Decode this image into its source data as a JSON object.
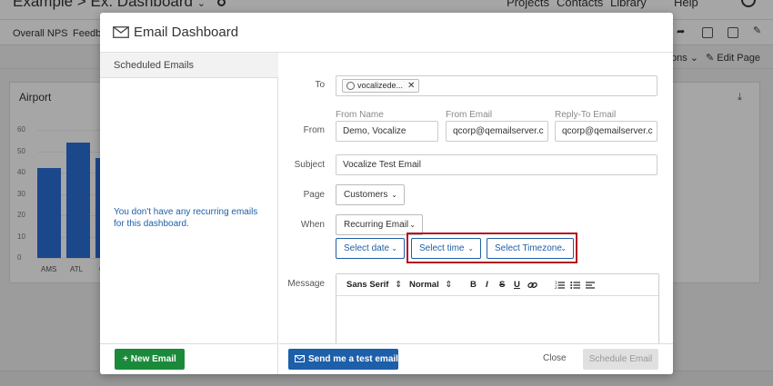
{
  "background": {
    "title": "Example  >  Ex. Dashboard",
    "title_chevron": "⌄",
    "settings_icon": "gear-icon",
    "top_nav": [
      "Projects",
      "Contacts",
      "Library",
      "Help"
    ],
    "tabs": [
      "Overall NPS",
      "Feedba"
    ],
    "sub_items": [
      "ons ⌄",
      "✎ Edit Page"
    ],
    "card_title": "Airport",
    "download_icon": "download-icon",
    "chart_data": {
      "type": "bar",
      "categories": [
        "AMS",
        "ATL",
        "C"
      ],
      "values": [
        42,
        54,
        47
      ],
      "ylim": [
        0,
        60
      ],
      "yticks": [
        "60",
        "50",
        "40",
        "30",
        "20",
        "10",
        "0"
      ],
      "bar_color": "#2a6ed6",
      "grid": true
    }
  },
  "modal": {
    "title": "Email Dashboard",
    "left": {
      "header": "Scheduled Emails",
      "empty_message": "You don't have any recurring emails for this dashboard.",
      "new_email_label": "+ New Email"
    },
    "form": {
      "to_label": "To",
      "to_chip": "vocalizede...",
      "to_chip_remove": "✕",
      "from_label": "From",
      "from_name_label": "From Name",
      "from_name_value": "Demo, Vocalize",
      "from_email_label": "From Email",
      "from_email_value": "qcorp@qemailserver.c",
      "reply_to_label": "Reply-To Email",
      "reply_to_value": "qcorp@qemailserver.c",
      "subject_label": "Subject",
      "subject_value": "Vocalize Test Email",
      "page_label": "Page",
      "page_value": "Customers",
      "when_label": "When",
      "when_value": "Recurring Email",
      "select_date": "Select date",
      "select_time": "Select time",
      "select_timezone": "Select Timezone",
      "message_label": "Message",
      "chevron": "⌄"
    },
    "editor_toolbar": {
      "font": "Sans Serif",
      "size": "Normal",
      "spinner": "⇕",
      "bold": "B",
      "italic": "I",
      "strike": "S",
      "underline": "U",
      "link_icon": "link-icon",
      "ordered_list_icon": "ordered-list-icon",
      "bullet_list_icon": "bullet-list-icon",
      "align_icon": "align-left-icon"
    },
    "footer": {
      "test_email_label": "Send me a test email",
      "close_label": "Close",
      "schedule_label": "Schedule Email"
    }
  },
  "colors": {
    "primary_blue": "#1d5fa8",
    "green": "#1a8a3a",
    "highlight_red": "#b1151f"
  }
}
